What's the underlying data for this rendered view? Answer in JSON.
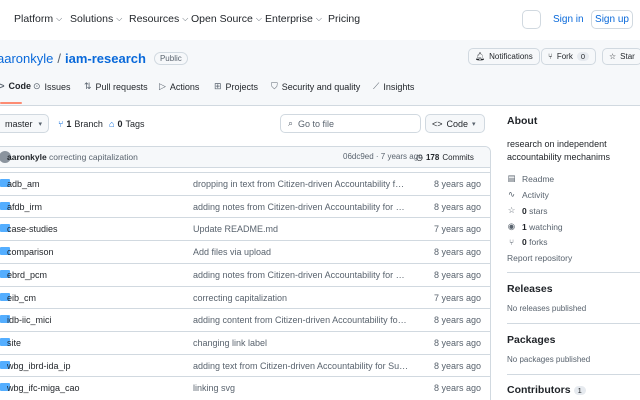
{
  "nav": {
    "items": [
      {
        "label": "Platform"
      },
      {
        "label": "Solutions"
      },
      {
        "label": "Resources"
      },
      {
        "label": "Open Source"
      },
      {
        "label": "Enterprise"
      }
    ],
    "pricing": "Pricing",
    "signin": "Sign in",
    "signup": "Sign up"
  },
  "repo": {
    "owner": "aaronkyle",
    "separator": "/",
    "name": "iam-research",
    "visibility": "Public",
    "notifications": "Notifications",
    "fork_label": "Fork",
    "fork_count": "0",
    "star_label": "Star"
  },
  "tabs": [
    {
      "label": "Code",
      "icon": "code-icon"
    },
    {
      "label": "Issues",
      "icon": "issue-icon"
    },
    {
      "label": "Pull requests",
      "icon": "pull-request-icon"
    },
    {
      "label": "Actions",
      "icon": "play-icon"
    },
    {
      "label": "Projects",
      "icon": "table-icon"
    },
    {
      "label": "Security and quality",
      "icon": "shield-icon"
    },
    {
      "label": "Insights",
      "icon": "graph-icon"
    }
  ],
  "controls": {
    "branch": "master",
    "branches_count": "1",
    "branches_label": "Branch",
    "tags_count": "0",
    "tags_label": "Tags",
    "goto_placeholder": "Go to file",
    "code_label": "Code"
  },
  "latest_commit": {
    "author": "aaronkyle",
    "message": "correcting capitalization",
    "sha_time": "06dc9ed · 7 years ago",
    "commits_count": "178",
    "commits_label": "Commits"
  },
  "files": [
    {
      "name": "adb_am",
      "message": "dropping in text from Citizen-driven Accountability for Sus...",
      "age": "8 years ago"
    },
    {
      "name": "afdb_irm",
      "message": "adding notes from Citizen-driven Accountability for Susta...",
      "age": "8 years ago"
    },
    {
      "name": "case-studies",
      "message": "Update README.md",
      "age": "7 years ago"
    },
    {
      "name": "comparison",
      "message": "Add files via upload",
      "age": "8 years ago"
    },
    {
      "name": "ebrd_pcm",
      "message": "adding notes from Citizen-driven Accountability for Susta...",
      "age": "8 years ago"
    },
    {
      "name": "eib_cm",
      "message": "correcting capitalization",
      "age": "7 years ago"
    },
    {
      "name": "idb-iic_mici",
      "message": "adding content from Citizen-driven Accountability for Sus...",
      "age": "8 years ago"
    },
    {
      "name": "site",
      "message": "changing link label",
      "age": "8 years ago"
    },
    {
      "name": "wbg_ibrd-ida_ip",
      "message": "adding text from Citizen-driven Accountability for Sustain...",
      "age": "8 years ago"
    },
    {
      "name": "wbg_ifc-miga_cao",
      "message": "linking svg",
      "age": "8 years ago"
    }
  ],
  "sidebar": {
    "about_title": "About",
    "description": "research on independent accountability mechanims",
    "readme": "Readme",
    "activity": "Activity",
    "stars_count": "0",
    "stars_label": "stars",
    "watching_count": "1",
    "watching_label": "watching",
    "forks_count": "0",
    "forks_label": "forks",
    "report": "Report repository",
    "releases_title": "Releases",
    "releases_empty": "No releases published",
    "packages_title": "Packages",
    "packages_empty": "No packages published",
    "contributors_title": "Contributors",
    "contributors_count": "1"
  },
  "colors": {
    "link": "#0969da",
    "folder": "#54aeff",
    "active_tab_underline": "#fd8c73",
    "border": "#d1d9e0"
  }
}
